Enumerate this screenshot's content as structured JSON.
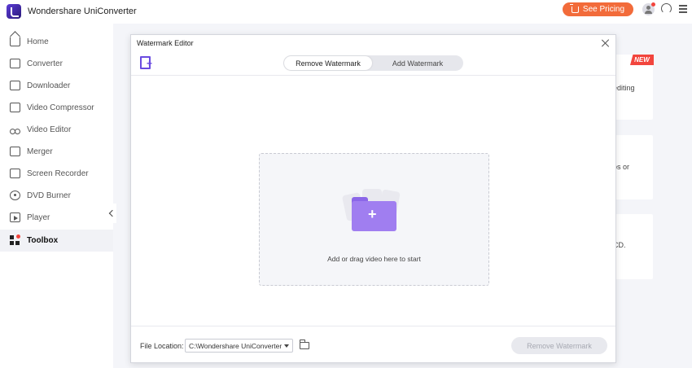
{
  "app": {
    "title": "Wondershare UniConverter",
    "pricing_label": "See Pricing"
  },
  "sidebar": {
    "items": [
      {
        "label": "Home",
        "icon": "home-icon"
      },
      {
        "label": "Converter",
        "icon": "converter-icon"
      },
      {
        "label": "Downloader",
        "icon": "downloader-icon"
      },
      {
        "label": "Video Compressor",
        "icon": "compressor-icon"
      },
      {
        "label": "Video Editor",
        "icon": "scissors-icon"
      },
      {
        "label": "Merger",
        "icon": "merger-icon"
      },
      {
        "label": "Screen Recorder",
        "icon": "recorder-icon"
      },
      {
        "label": "DVD Burner",
        "icon": "disc-icon"
      },
      {
        "label": "Player",
        "icon": "player-icon"
      },
      {
        "label": "Toolbox",
        "icon": "toolbox-icon",
        "active": true
      }
    ]
  },
  "background_cards": {
    "badge": "NEW",
    "snippets": [
      "editing",
      "os or",
      "CD."
    ]
  },
  "dialog": {
    "title": "Watermark Editor",
    "tabs": [
      {
        "label": "Remove Watermark",
        "active": true
      },
      {
        "label": "Add Watermark",
        "active": false
      }
    ],
    "dropzone_text": "Add or drag video here to start",
    "file_location_label": "File Location:",
    "file_location_value": "C:\\Wondershare UniConverter",
    "action_button": "Remove Watermark"
  },
  "colors": {
    "accent": "#6a4be0",
    "pricing": "#f26b3a",
    "badge": "#f2453d"
  }
}
